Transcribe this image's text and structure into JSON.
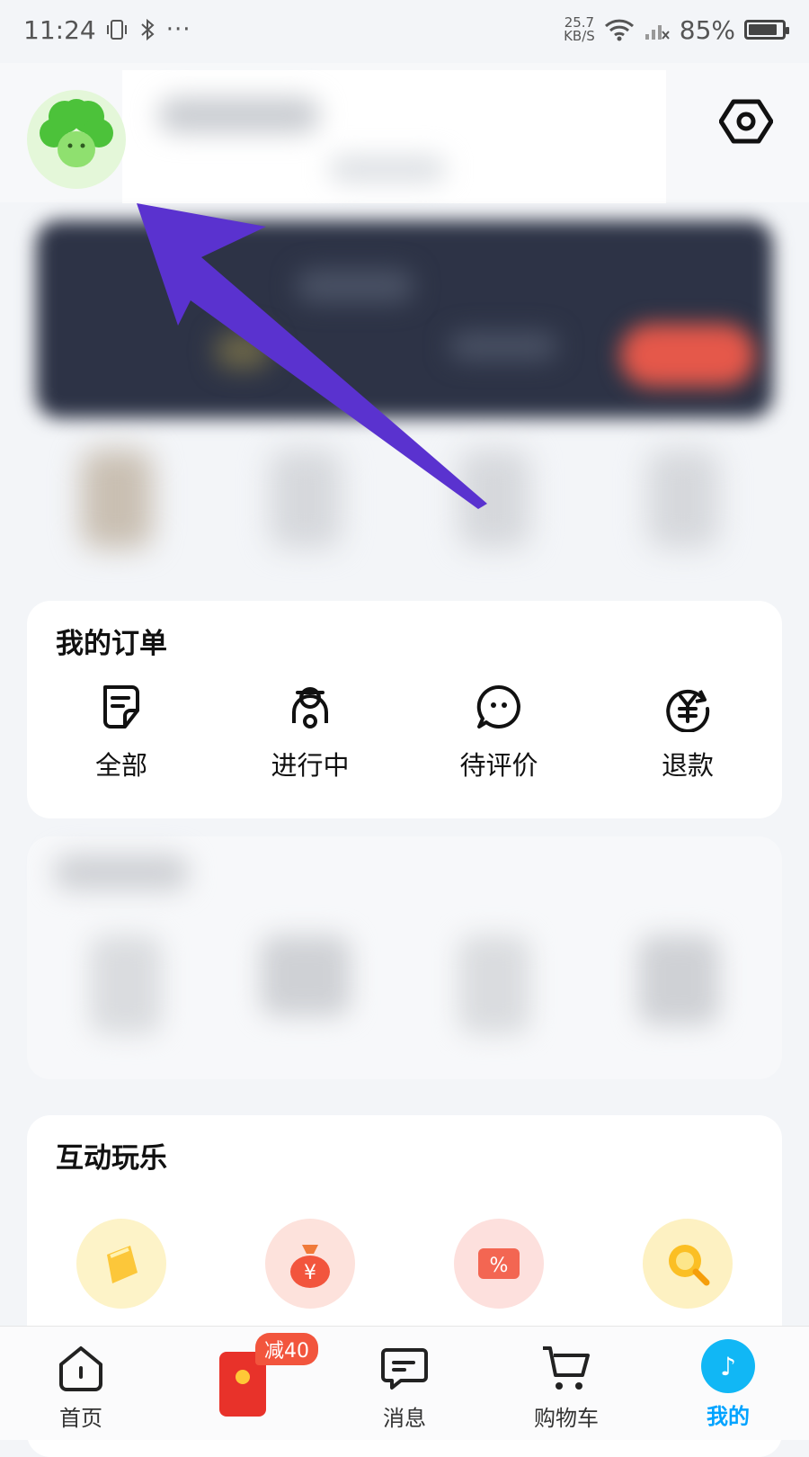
{
  "status_bar": {
    "time": "11:24",
    "net_speed_value": "25.7",
    "net_speed_unit": "KB/S",
    "battery": "85%",
    "battery_level": 0.85
  },
  "orders": {
    "title": "我的订单",
    "items": [
      {
        "label": "全部",
        "icon": "document-icon"
      },
      {
        "label": "进行中",
        "icon": "scooter-rider-icon"
      },
      {
        "label": "待评价",
        "icon": "chat-bubble-icon"
      },
      {
        "label": "退款",
        "icon": "yuan-refund-icon"
      }
    ]
  },
  "fun": {
    "title": "互动玩乐",
    "items": [
      {
        "icon": "yellow-coin-icon",
        "color": "#fcd34d"
      },
      {
        "icon": "money-bag-icon",
        "color": "#f96a4f"
      },
      {
        "icon": "discount-ticket-icon",
        "color": "#f36652"
      },
      {
        "icon": "magnifier-icon",
        "color": "#fbbf24"
      }
    ]
  },
  "tabbar": {
    "items": [
      {
        "label": "首页",
        "icon": "home-icon"
      },
      {
        "label": "",
        "icon": "red-packet-icon",
        "badge": "减40"
      },
      {
        "label": "消息",
        "icon": "message-icon"
      },
      {
        "label": "购物车",
        "icon": "cart-icon"
      },
      {
        "label": "我的",
        "icon": "me-icon"
      }
    ],
    "active_color": "#00a3ff"
  },
  "colors": {
    "arrow": "#5a32cf",
    "accent": "#00a3ff"
  }
}
